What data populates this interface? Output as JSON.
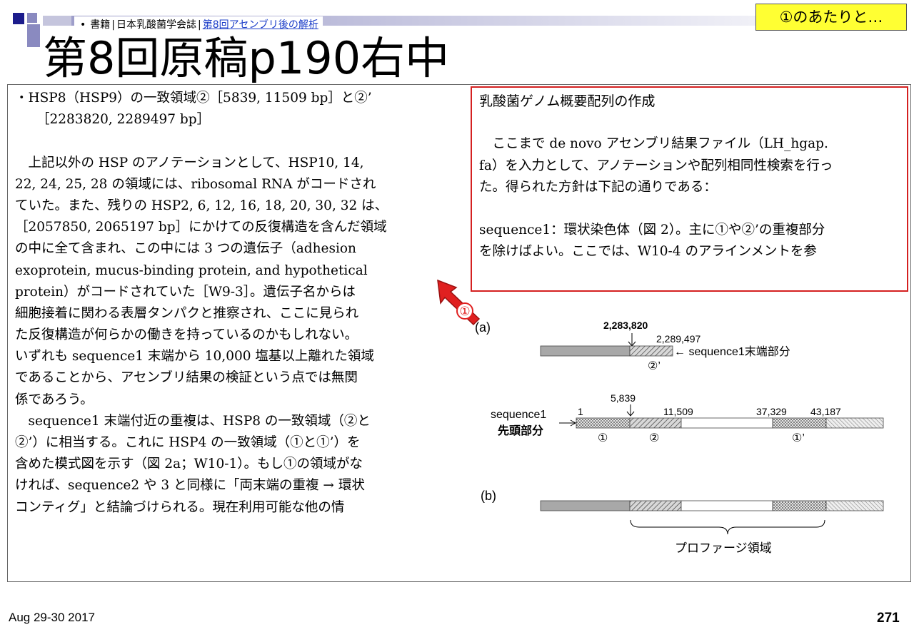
{
  "header": {
    "breadcrumb_bullet": "•",
    "breadcrumb_part1": "書籍",
    "breadcrumb_sep1": "|",
    "breadcrumb_part2": "日本乳酸菌学会誌",
    "breadcrumb_sep2": "|",
    "breadcrumb_link": "第8回アセンブリ後の解析",
    "callout": "①のあたりと…",
    "title": "第8回原稿p190右中",
    "colors": {
      "band_dark": "#1c1c8c",
      "callout_bg": "#ffff33",
      "highlight_box": "#d42020",
      "link": "#1a3cc8"
    }
  },
  "left_column": {
    "lines": [
      "・HSP8（HSP9）の一致領域②［5839, 11509 bp］と②’",
      "［2283820, 2289497 bp］",
      "",
      "　上記以外の HSP のアノテーションとして、HSP10, 14,",
      "22, 24, 25, 28 の領域には、ribosomal RNA がコードされ",
      "ていた。また、残りの HSP2, 6, 12, 16, 18, 20, 30, 32 は、",
      "［2057850, 2065197 bp］にかけての反復構造を含んだ領域",
      "の中に全て含まれ、この中には 3 つの遺伝子（adhesion",
      "exoprotein, mucus-binding protein, and hypothetical",
      "protein）がコードされていた［W9-3］。遺伝子名からは",
      "細胞接着に関わる表層タンパクと推察され、ここに見られ",
      "た反復構造が何らかの働きを持っているのかもしれない。",
      "いずれも sequence1 末端から 10,000 塩基以上離れた領域",
      "であることから、アセンブリ結果の検証という点では無関",
      "係であろう。",
      "　sequence1 末端付近の重複は、HSP8 の一致領域（②と",
      "②’）に相当する。これに HSP4 の一致領域（①と①’）を",
      "含めた模式図を示す（図 2a；W10-1）。もし①の領域がな",
      "ければ、sequence2 や 3 と同様に「両末端の重複 → 環状",
      "コンティグ」と結論づけられる。現在利用可能な他の情"
    ]
  },
  "right_column": {
    "heading": "乳酸菌ゲノム概要配列の作成",
    "lines": [
      "　ここまで de novo アセンブリ結果ファイル（LH_hgap.",
      "fa）を入力として、アノテーションや配列相同性検索を行っ",
      "た。得られた方針は下記の通りである：",
      "",
      "sequence1：環状染色体（図 2）。主に①や②’の重複部分",
      "を除けばよい。ここでは、W10-4 のアラインメントを参"
    ]
  },
  "marker": {
    "label": "①",
    "color": "#e02020"
  },
  "figure": {
    "panel_a": {
      "label": "(a)",
      "top_numbers": [
        "2,283,820",
        "2,289,497"
      ],
      "top_arrow_text": "← sequence1末端部分",
      "top_region": "②’",
      "seq_label_line1": "sequence1",
      "seq_label_line2": "先頭部分",
      "bottom_numbers": [
        "1",
        "5,839",
        "11,509",
        "37,329",
        "43,187"
      ],
      "bottom_regions": [
        "①",
        "②",
        "①’"
      ]
    },
    "panel_b": {
      "label": "(b)",
      "brace_label": "プロファージ領域"
    }
  },
  "footer": {
    "date": "Aug 29-30 2017",
    "page": "271"
  }
}
